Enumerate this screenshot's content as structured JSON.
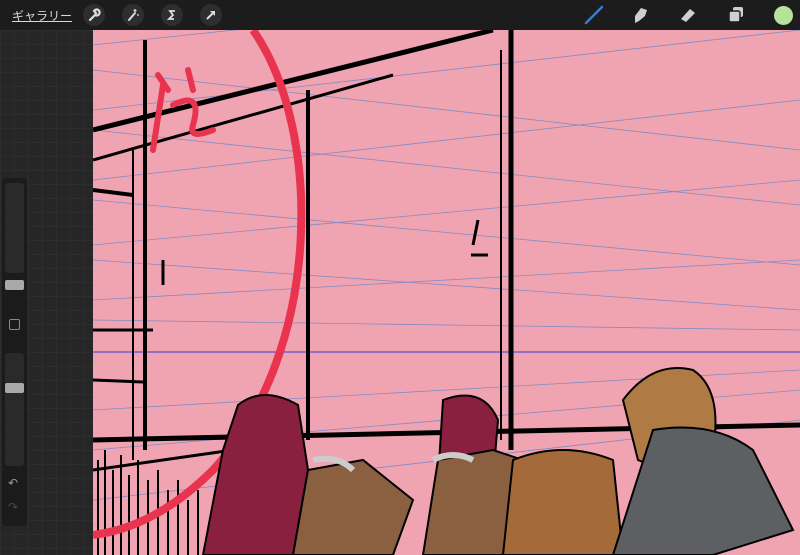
{
  "topbar": {
    "gallery_label": "ギャラリー",
    "left_tools": [
      "wrench-icon",
      "magic-wand-icon",
      "selection-icon",
      "transform-arrow-icon"
    ],
    "right_tools": [
      "brush-icon",
      "smudge-icon",
      "eraser-icon",
      "layers-icon",
      "color-icon"
    ],
    "active_tool": "brush",
    "active_color": "#b6e39c",
    "brush_accent": "#2f7de1"
  },
  "sidebar": {
    "brush_size": 0.1,
    "opacity": 0.75,
    "undo_label": "↶",
    "redo_label": "↷"
  },
  "canvas": {
    "background": "#f0a4b2",
    "stroke_red": "#e8344e"
  }
}
